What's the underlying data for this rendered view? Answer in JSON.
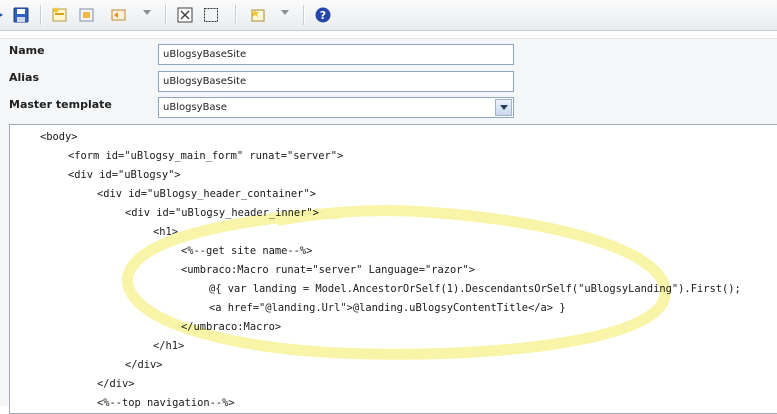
{
  "toolbar": {
    "buttons": [
      {
        "icon": "save-icon"
      },
      {
        "icon": "insert-field-icon"
      },
      {
        "icon": "insert-inline-razor-icon"
      },
      {
        "icon": "insert-macro-icon"
      },
      {
        "icon": "insert-content-area-icon"
      },
      {
        "icon": "insert-placeholder-icon"
      },
      {
        "icon": "insert-master-content-icon"
      },
      {
        "icon": "help-icon"
      }
    ]
  },
  "form": {
    "name_label": "Name",
    "name_value": "uBlogsyBaseSite",
    "alias_label": "Alias",
    "alias_value": "uBlogsyBaseSite",
    "master_label": "Master template",
    "master_value": "uBlogsyBase"
  },
  "code_lines": [
    "<body>",
    "<form id=\"uBlogsy_main_form\" runat=\"server\">",
    "<div id=\"uBlogsy\">",
    "<div id=\"uBlogsy_header_container\">",
    "<div id=\"uBlogsy_header_inner\">",
    "<h1>",
    "<%--get site name--%>",
    "<umbraco:Macro runat=\"server\" Language=\"razor\">",
    "@{ var landing = Model.AncestorOrSelf(1).DescendantsOrSelf(\"uBlogsyLanding\").First();",
    "<a href=\"@landing.Url\">@landing.uBlogsyContentTitle</a> }",
    "</umbraco:Macro>",
    "</h1>",
    "</div>",
    "</div>",
    "<%--top navigation--%>"
  ],
  "colors": {
    "highlight": "#f7f39a",
    "help": "#2447a8"
  }
}
